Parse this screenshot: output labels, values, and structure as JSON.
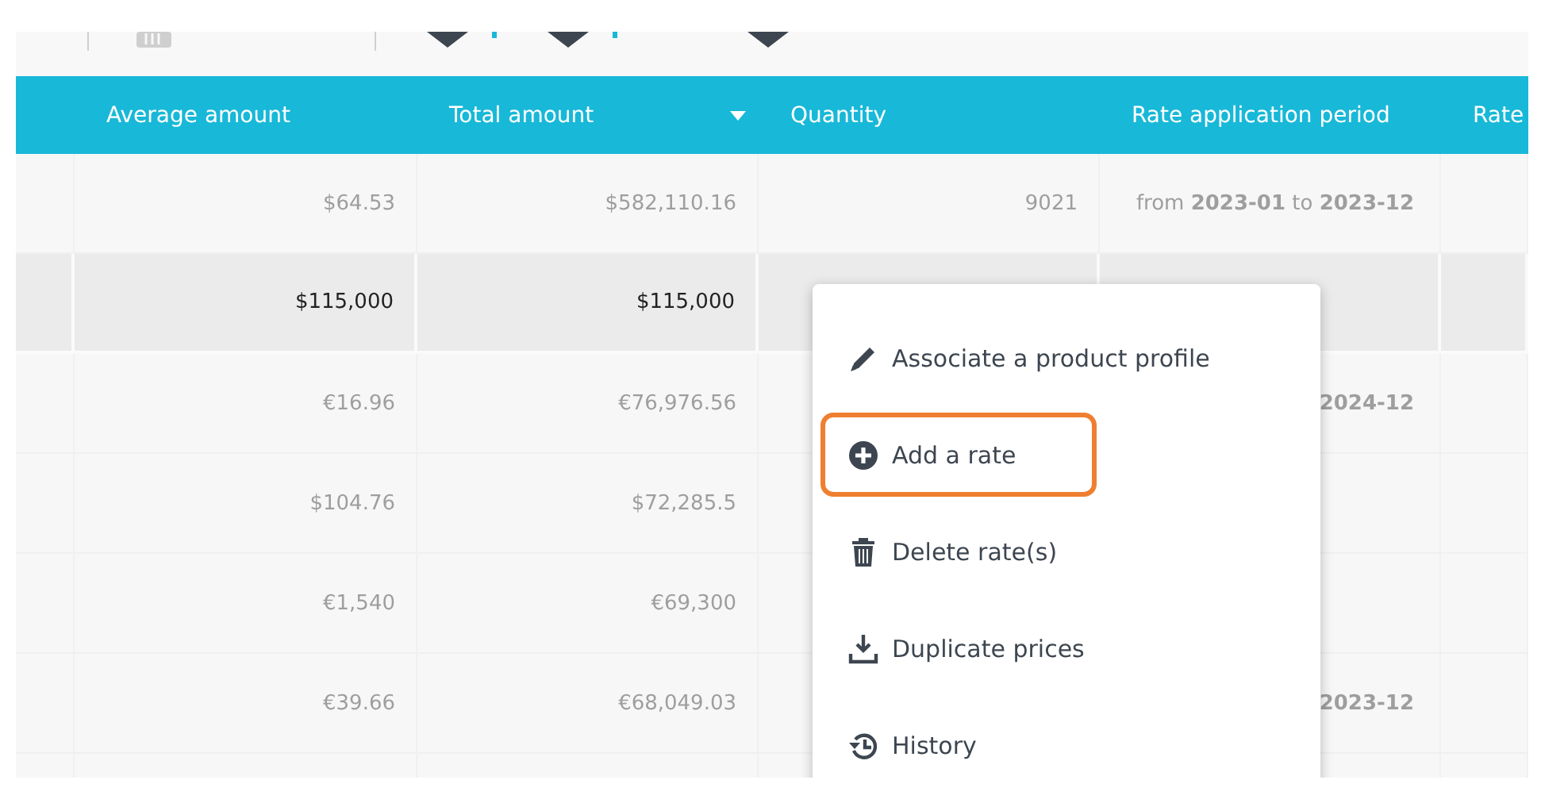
{
  "toolbar": {
    "icons": [
      {
        "kind": "muted"
      },
      {
        "kind": "dark"
      },
      {
        "kind": "dot"
      },
      {
        "kind": "dark"
      },
      {
        "kind": "dot"
      },
      {
        "kind": "dark"
      }
    ]
  },
  "table": {
    "columns": [
      {
        "label": "Average amount",
        "sorted": false
      },
      {
        "label": "Total amount",
        "sorted": true
      },
      {
        "label": "Quantity",
        "sorted": false
      },
      {
        "label": "Rate application period",
        "sorted": false
      },
      {
        "label": "Rate",
        "sorted": false
      }
    ],
    "rows": [
      {
        "selected": false,
        "average": "$64.53",
        "total": "$582,110.16",
        "quantity": "9021",
        "period": "from **2023-01** to **2023-12**"
      },
      {
        "selected": true,
        "average": "$115,000",
        "total": "$115,000",
        "quantity": "",
        "period": ""
      },
      {
        "selected": false,
        "average": "€16.96",
        "total": "€76,976.56",
        "quantity": "",
        "period": "**2024-12**"
      },
      {
        "selected": false,
        "average": "$104.76",
        "total": "$72,285.5",
        "quantity": "",
        "period": ""
      },
      {
        "selected": false,
        "average": "€1,540",
        "total": "€69,300",
        "quantity": "",
        "period": ""
      },
      {
        "selected": false,
        "average": "€39.66",
        "total": "€68,049.03",
        "quantity": "",
        "period": "**2023-12**"
      },
      {
        "selected": false,
        "average": "",
        "total": "",
        "quantity": "",
        "period": ""
      }
    ]
  },
  "context_menu": {
    "items": [
      {
        "kind": "pencil",
        "label": "Associate a product profile",
        "highlighted": false
      },
      {
        "kind": "plus",
        "label": "Add a rate",
        "highlighted": true
      },
      {
        "kind": "trash",
        "label": "Delete rate(s)",
        "highlighted": false
      },
      {
        "kind": "download",
        "label": "Duplicate prices",
        "highlighted": false
      },
      {
        "kind": "history",
        "label": "History",
        "highlighted": false
      }
    ]
  }
}
